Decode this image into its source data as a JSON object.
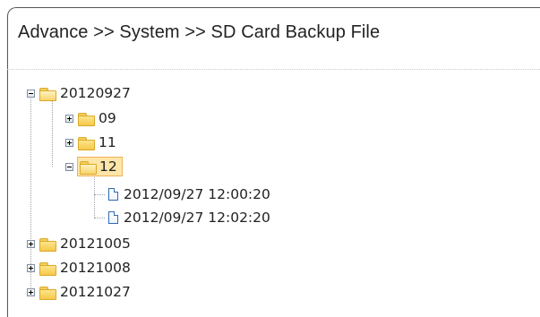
{
  "breadcrumb": "Advance >> System >> SD Card Backup File",
  "tree": {
    "root": {
      "label": "20120927",
      "expanded": true
    },
    "children": [
      {
        "label": "09",
        "expanded": false
      },
      {
        "label": "11",
        "expanded": false
      },
      {
        "label": "12",
        "expanded": true,
        "selected": true,
        "files": [
          "2012/09/27 12:00:20",
          "2012/09/27 12:02:20"
        ]
      }
    ],
    "siblings": [
      {
        "label": "20121005",
        "expanded": false
      },
      {
        "label": "20121008",
        "expanded": false
      },
      {
        "label": "20121027",
        "expanded": false
      }
    ]
  },
  "colors": {
    "selection_bg": "#fde6a8",
    "selection_border": "#f0b15a",
    "folder": "#f5c94a",
    "file_border": "#2e6bb3"
  }
}
